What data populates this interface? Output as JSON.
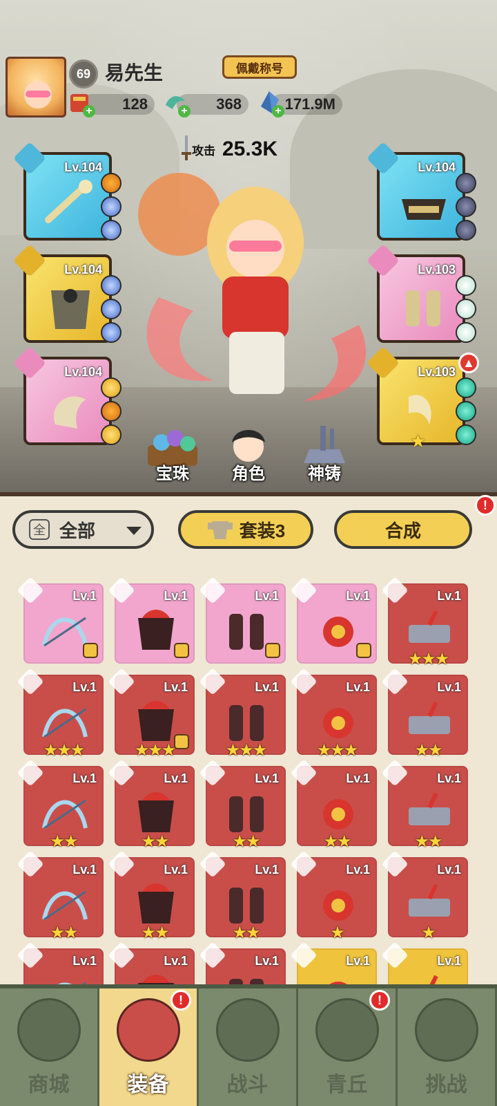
{
  "player": {
    "level": "69",
    "name": "易先生",
    "title_button": "佩戴称号"
  },
  "resources": [
    {
      "icon": "scroll-gift-icon",
      "value": "128"
    },
    {
      "icon": "green-dragon-icon",
      "value": "368"
    },
    {
      "icon": "crystal-icon",
      "value": "171.9M"
    }
  ],
  "power": {
    "label": "攻击",
    "value": "25.3K"
  },
  "equipped": {
    "left": [
      {
        "lv": "Lv.104",
        "slot_icon": "sword-icon",
        "color": "blue"
      },
      {
        "lv": "Lv.104",
        "slot_icon": "chest-icon",
        "color": "yellow"
      },
      {
        "lv": "Lv.104",
        "slot_icon": "ring-icon",
        "color": "pink"
      }
    ],
    "right": [
      {
        "lv": "Lv.104",
        "slot_icon": "belt-icon",
        "color": "blue"
      },
      {
        "lv": "Lv.103",
        "slot_icon": "boots-icon",
        "color": "pink"
      },
      {
        "lv": "Lv.103",
        "slot_icon": "amulet-icon",
        "color": "yellow",
        "stars": "★"
      }
    ]
  },
  "mid_buttons": [
    "宝珠",
    "角色",
    "神铸"
  ],
  "filter": {
    "box": "全",
    "label": "全部"
  },
  "set_button": "套装3",
  "synth_button": "合成",
  "alert_mark": "!",
  "inventory": [
    {
      "lv": "Lv.1",
      "color": "pink",
      "stars": "",
      "badge": true
    },
    {
      "lv": "Lv.1",
      "color": "pink",
      "stars": "",
      "badge": true
    },
    {
      "lv": "Lv.1",
      "color": "pink",
      "stars": "",
      "badge": true
    },
    {
      "lv": "Lv.1",
      "color": "pink",
      "stars": "",
      "badge": true
    },
    {
      "lv": "Lv.1",
      "color": "red",
      "stars": "★★★",
      "badge": false
    },
    {
      "lv": "Lv.1",
      "color": "red",
      "stars": "★★★",
      "badge": false
    },
    {
      "lv": "Lv.1",
      "color": "red",
      "stars": "★★★",
      "badge": true
    },
    {
      "lv": "Lv.1",
      "color": "red",
      "stars": "★★★",
      "badge": false
    },
    {
      "lv": "Lv.1",
      "color": "red",
      "stars": "★★★",
      "badge": false
    },
    {
      "lv": "Lv.1",
      "color": "red",
      "stars": "★★",
      "badge": false
    },
    {
      "lv": "Lv.1",
      "color": "red",
      "stars": "★★",
      "badge": false
    },
    {
      "lv": "Lv.1",
      "color": "red",
      "stars": "★★",
      "badge": false
    },
    {
      "lv": "Lv.1",
      "color": "red",
      "stars": "★★",
      "badge": false
    },
    {
      "lv": "Lv.1",
      "color": "red",
      "stars": "★★",
      "badge": false
    },
    {
      "lv": "Lv.1",
      "color": "red",
      "stars": "★★",
      "badge": false
    },
    {
      "lv": "Lv.1",
      "color": "red",
      "stars": "★★",
      "badge": false
    },
    {
      "lv": "Lv.1",
      "color": "red",
      "stars": "★★",
      "badge": false
    },
    {
      "lv": "Lv.1",
      "color": "red",
      "stars": "★★",
      "badge": false
    },
    {
      "lv": "Lv.1",
      "color": "red",
      "stars": "★",
      "badge": false
    },
    {
      "lv": "Lv.1",
      "color": "red",
      "stars": "★",
      "badge": false
    },
    {
      "lv": "Lv.1",
      "color": "red",
      "stars": "",
      "badge": false
    },
    {
      "lv": "Lv.1",
      "color": "red",
      "stars": "",
      "badge": false
    },
    {
      "lv": "Lv.1",
      "color": "red",
      "stars": "",
      "badge": false
    },
    {
      "lv": "Lv.1",
      "color": "gold",
      "stars": "",
      "badge": false
    },
    {
      "lv": "Lv.1",
      "color": "gold",
      "stars": "",
      "badge": false
    }
  ],
  "nav": [
    {
      "label": "商城",
      "icon": "shop-pagoda-icon",
      "active": false,
      "alert": false
    },
    {
      "label": "装备",
      "icon": "helmet-icon",
      "active": true,
      "alert": true
    },
    {
      "label": "战斗",
      "icon": "crossed-swords-icon",
      "active": false,
      "alert": false
    },
    {
      "label": "青丘",
      "icon": "mountain-icon",
      "active": false,
      "alert": true
    },
    {
      "label": "挑战",
      "icon": "challenge-drum-icon",
      "active": false,
      "alert": false
    }
  ]
}
